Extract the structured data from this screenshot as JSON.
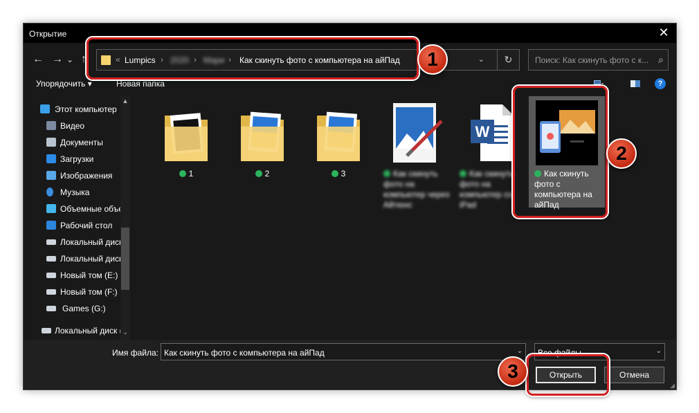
{
  "window": {
    "title": "Открытие",
    "close_glyph": "✕"
  },
  "nav": {
    "back": "←",
    "forward": "→",
    "recent": "⌄",
    "up": "↑"
  },
  "address": {
    "prefix": "«",
    "crumbs": [
      {
        "label": "Lumpics"
      },
      {
        "label": "2020"
      },
      {
        "label": "Мари"
      },
      {
        "label": "Как скинуть фото с компьютера на айПад"
      }
    ],
    "separator": "›",
    "dropdown_glyph": "⌄",
    "refresh_glyph": "↻"
  },
  "search": {
    "placeholder": "Поиск: Как скинуть фото с к...",
    "icon_glyph": "⌕"
  },
  "toolbar": {
    "organize_label": "Упорядочить ▾",
    "new_folder_label": "Новая папка",
    "help_glyph": "?"
  },
  "sidebar": {
    "items": [
      {
        "label": "Этот компьютер",
        "icon": "computer-icon",
        "color": "#3aa0e8"
      },
      {
        "label": "Видео",
        "icon": "video-icon",
        "color": "#7c8ba0"
      },
      {
        "label": "Документы",
        "icon": "documents-icon",
        "color": "#b9c3cf"
      },
      {
        "label": "Загрузки",
        "icon": "downloads-icon",
        "color": "#2c8be6"
      },
      {
        "label": "Изображения",
        "icon": "pictures-icon",
        "color": "#58a7e6"
      },
      {
        "label": "Музыка",
        "icon": "music-icon",
        "color": "#3b8ee0"
      },
      {
        "label": "Объемные объекты",
        "icon": "3d-objects-icon",
        "color": "#45b6ea"
      },
      {
        "label": "Рабочий стол",
        "icon": "desktop-icon",
        "color": "#2d86dd"
      },
      {
        "label": "Локальный диск (C:)",
        "icon": "drive-icon",
        "color": "#cfd5dc"
      },
      {
        "label": "Локальный диск (D:)",
        "icon": "drive-icon",
        "color": "#cfd5dc"
      },
      {
        "label": "Новый том (E:)",
        "icon": "drive-icon",
        "color": "#cfd5dc"
      },
      {
        "label": "Новый том (F:)",
        "icon": "drive-icon",
        "color": "#cfd5dc"
      },
      {
        "label": "Games (G:)",
        "icon": "drive-icon",
        "color": "#cfd5dc"
      },
      {
        "label": "Локальный диск (C:)",
        "icon": "drive-icon",
        "color": "#cfd5dc"
      }
    ],
    "scroll_up": "▲",
    "scroll_down": "▼",
    "collapse_glyph": "⌄"
  },
  "files": [
    {
      "name": "1",
      "type": "folder",
      "synced": true
    },
    {
      "name": "2",
      "type": "folder",
      "synced": true
    },
    {
      "name": "3",
      "type": "folder",
      "synced": true
    },
    {
      "name": "Как скинуть фото на компьютер через Айтюнс",
      "type": "image",
      "synced": true
    },
    {
      "name": "Как скинуть фото на компьютер со iPad",
      "type": "word",
      "synced": true
    },
    {
      "name": "Как скинуть фото с компьютера на айПад",
      "type": "image-selected",
      "synced": true
    }
  ],
  "bottom": {
    "filename_label": "Имя файла:",
    "filename_value": "Как скинуть фото с компьютера на айПад",
    "filetype_value": "Все файлы",
    "open_label": "Открыть",
    "cancel_label": "Отмена",
    "dropdown_glyph": "⌄"
  },
  "callouts": {
    "one": "1",
    "two": "2",
    "three": "3"
  },
  "colors": {
    "callout": "#d32020",
    "marker": "#e0452a",
    "check": "#2db35d",
    "selected_bg": "#5a5a5a"
  }
}
